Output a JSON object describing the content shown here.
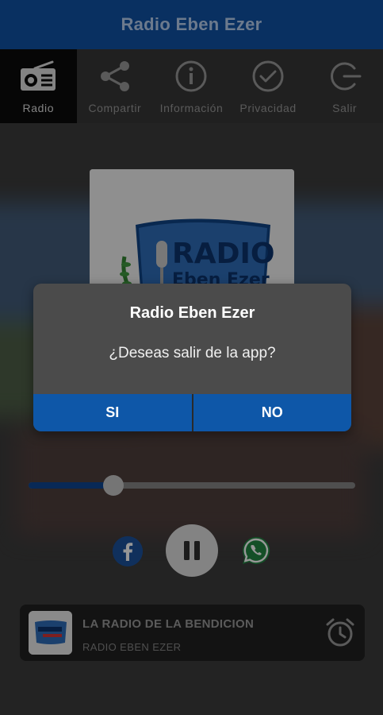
{
  "app": {
    "title": "Radio Eben Ezer"
  },
  "tabs": [
    {
      "label": "Radio",
      "icon": "radio-icon",
      "active": true
    },
    {
      "label": "Compartir",
      "icon": "share-icon",
      "active": false
    },
    {
      "label": "Información",
      "icon": "info-icon",
      "active": false
    },
    {
      "label": "Privacidad",
      "icon": "check-circle-icon",
      "active": false
    },
    {
      "label": "Salir",
      "icon": "exit-icon",
      "active": false
    }
  ],
  "artwork": {
    "logo_line1": "RADIO",
    "logo_line2": "Eben Ezer"
  },
  "dialog": {
    "title": "Radio Eben Ezer",
    "message": "¿Deseas salir de la app?",
    "yes_label": "SI",
    "no_label": "NO"
  },
  "player": {
    "volume_fraction": 0.26,
    "state": "playing"
  },
  "now_playing": {
    "title": "LA RADIO DE LA BENDICION",
    "station": "RADIO EBEN EZER"
  },
  "colors": {
    "brand_blue": "#0f4a96",
    "dialog_button": "#0e57a8",
    "tab_active_bg": "#0a0a0a",
    "whatsapp_green": "#1f7a3d",
    "facebook_blue": "#1a4a8e"
  }
}
